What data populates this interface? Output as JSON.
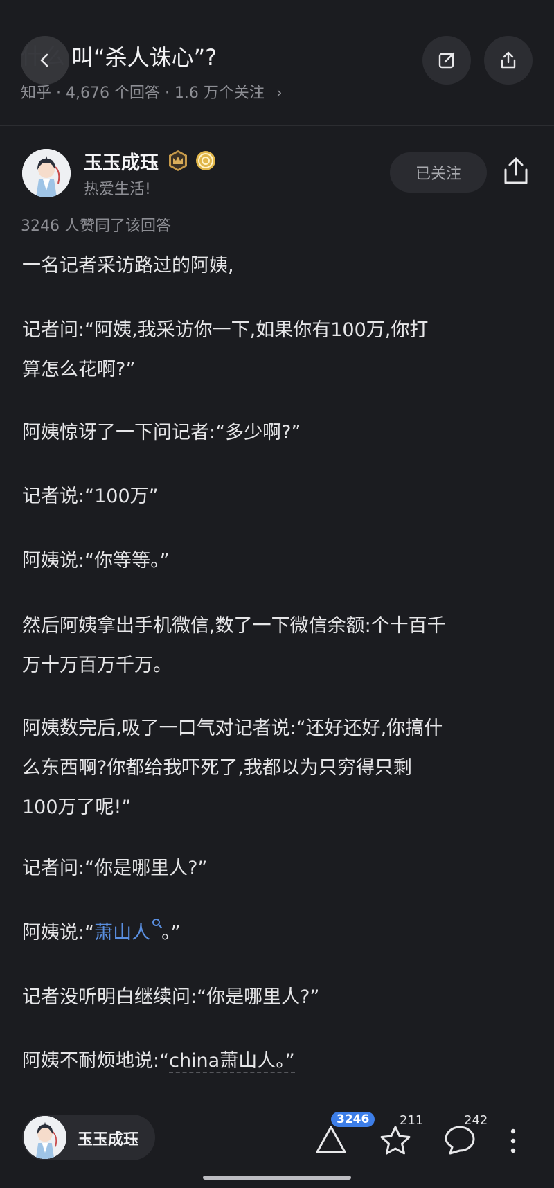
{
  "header": {
    "ghost_title": "什么",
    "question_title": "叫“杀人诛心”?",
    "meta": "知乎 · 4,676 个回答 · 1.6 万个关注",
    "meta_chevron": "›",
    "icons": {
      "back": "chevron-left-icon",
      "edit": "edit-icon",
      "share": "share-icon"
    }
  },
  "author": {
    "name": "玉玉成珏",
    "bio": "热爱生活!",
    "follow_label": "已关注",
    "badges": [
      "crown-badge-icon",
      "coin-badge-icon"
    ]
  },
  "upvote_summary": "3246 人赞同了该回答",
  "article": {
    "paragraphs": [
      [
        "一名记者采访路过的阿姨,"
      ],
      [
        "记者问:“阿姨,我采访你一下,如果你有100万,你打",
        "算怎么花啊?”"
      ],
      [
        "阿姨惊讶了一下问记者:“多少啊?”"
      ],
      [
        "记者说:“100万”"
      ],
      [
        "阿姨说:“你等等。”"
      ],
      [
        "然后阿姨拿出手机微信,数了一下微信余额:个十百千",
        "万十万百万千万。"
      ],
      [
        "阿姨数完后,吸了一口气对记者说:“还好还好,你搞什",
        "么东西啊?你都给我吓死了,我都以为只穷得只剩",
        "100万了呢!”"
      ],
      [
        "记者问:“你是哪里人?”"
      ],
      [
        "阿姨说:“"
      ],
      [
        "记者没听明白继续问:“你是哪里人?”"
      ],
      [
        "阿姨不耐烦地说:“"
      ]
    ],
    "p9_link": "萧山人",
    "p9_tail": "。”",
    "p11_dashed": "china萧山人。”"
  },
  "bottom_bar": {
    "author_name": "玉玉成珏",
    "upvotes": "3246",
    "favorites": "211",
    "comments": "242"
  },
  "colors": {
    "background": "#1b1c20",
    "accent": "#3d7ee8",
    "link": "#5a8fe0"
  }
}
